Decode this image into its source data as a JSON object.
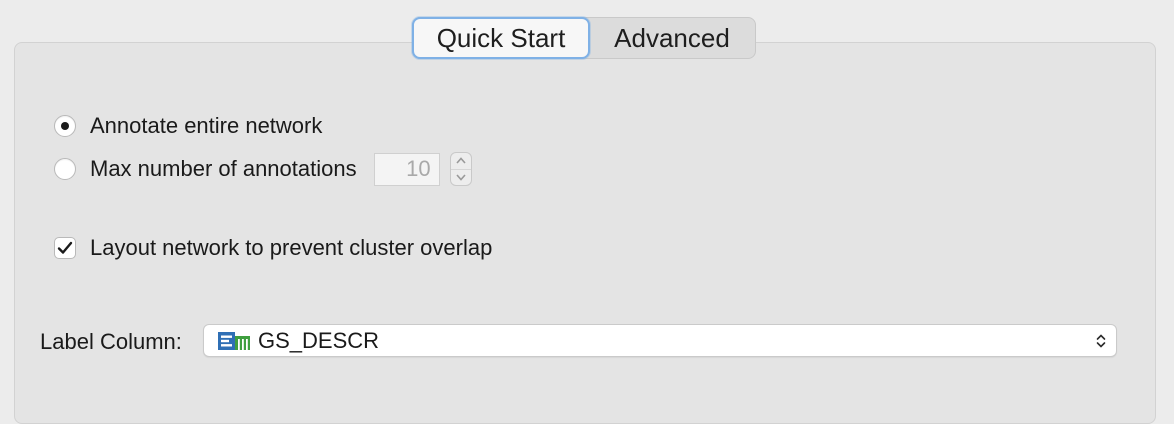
{
  "tabs": {
    "quick_start": "Quick Start",
    "advanced": "Advanced"
  },
  "options": {
    "annotate_entire_network": "Annotate entire network",
    "max_annotations_label": "Max number of annotations",
    "max_annotations_value": "10",
    "selected_mode": "annotate_entire_network",
    "layout_network_label": "Layout network to prevent cluster overlap",
    "layout_network_checked": true
  },
  "label_column": {
    "label": "Label Column:",
    "selected": "GS_DESCR",
    "icon": "string-column-icon"
  },
  "colors": {
    "accent": "#7fb1e6",
    "column_icon_blue": "#2f6fb5",
    "column_icon_green": "#3f9f3f"
  }
}
